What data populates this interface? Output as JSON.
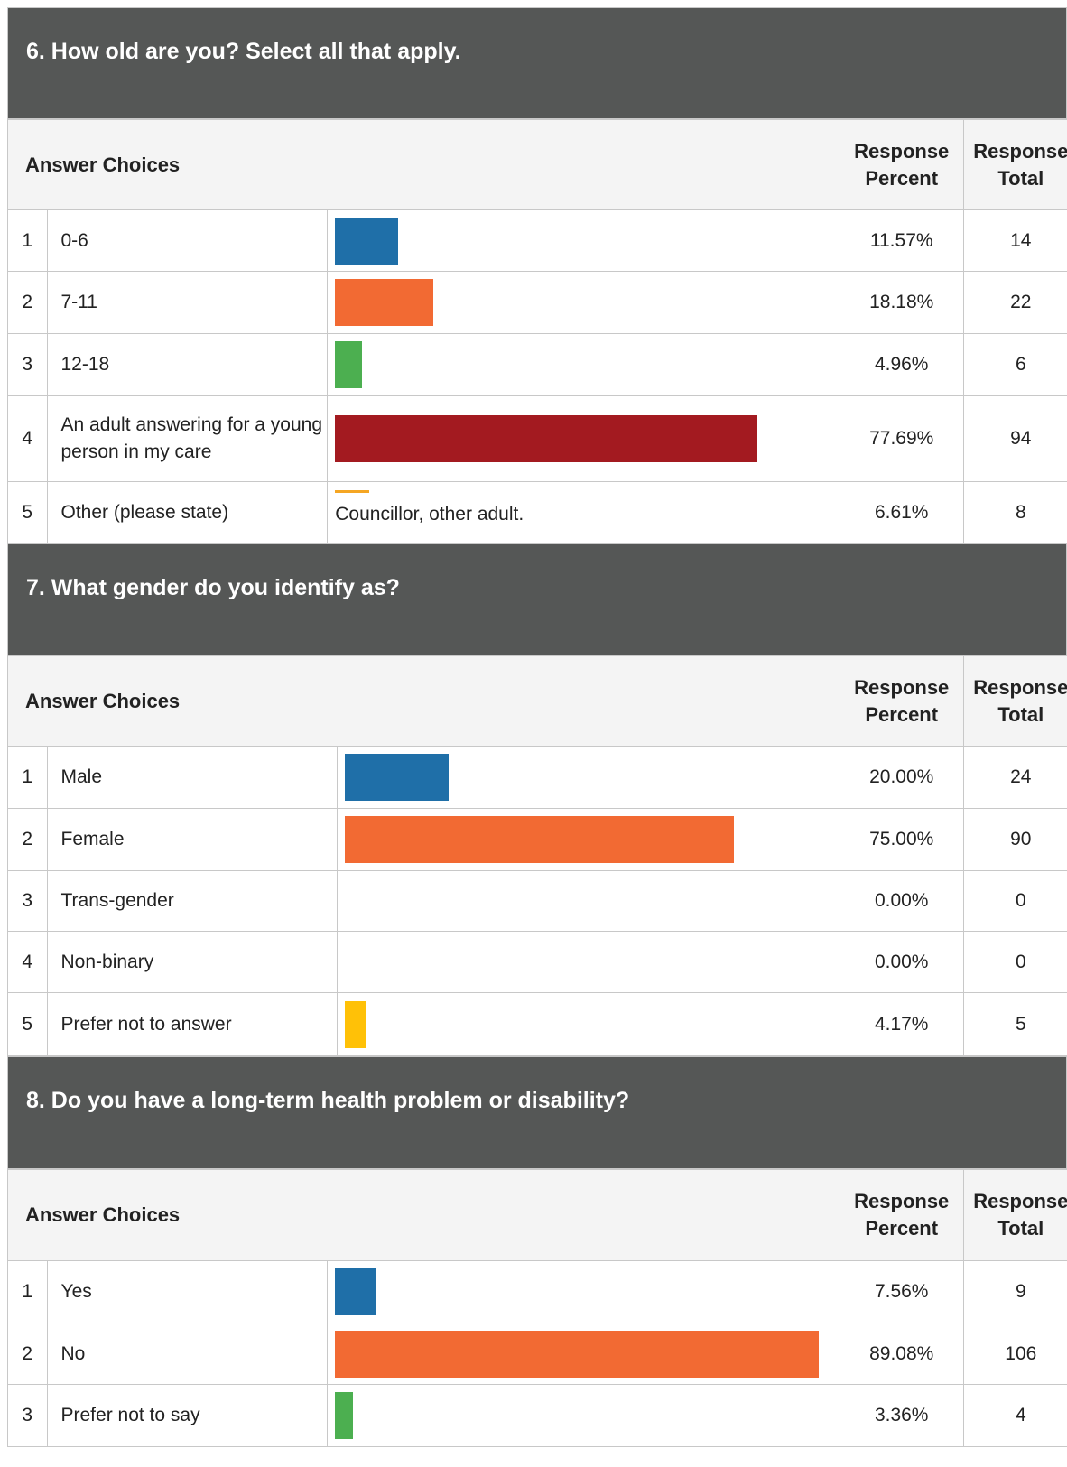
{
  "questions": [
    {
      "title": "6. How old are you? Select all that apply.",
      "header": {
        "answer_choices": "Answer Choices",
        "percent_line1": "Response",
        "percent_line2": "Percent",
        "total_line1": "Response",
        "total_line2": "Total"
      },
      "rows": [
        {
          "n": "1",
          "label": "0-6",
          "percent": "11.57%",
          "total": "14",
          "value": 11.57,
          "color": "#1f6fa8"
        },
        {
          "n": "2",
          "label": "7-11",
          "percent": "18.18%",
          "total": "22",
          "value": 18.18,
          "color": "#f26a33"
        },
        {
          "n": "3",
          "label": "12-18",
          "percent": "4.96%",
          "total": "6",
          "value": 4.96,
          "color": "#4caf50"
        },
        {
          "n": "4",
          "label": "An adult answering for a young person in my care",
          "percent": "77.69%",
          "total": "94",
          "value": 77.69,
          "color": "#a31a20"
        },
        {
          "n": "5",
          "label": "Other (please state)",
          "percent": "6.61%",
          "total": "8",
          "value": 6.61,
          "color": "#f5a623",
          "other_text": "Councillor, other adult."
        }
      ]
    },
    {
      "title": "7. What gender do you identify as?",
      "header": {
        "answer_choices": "Answer Choices",
        "percent_line1": "Response",
        "percent_line2": "Percent",
        "total_line1": "Response",
        "total_line2": "Total"
      },
      "rows": [
        {
          "n": "1",
          "label": "Male",
          "percent": "20.00%",
          "total": "24",
          "value": 20.0,
          "color": "#1f6fa8"
        },
        {
          "n": "2",
          "label": "Female",
          "percent": "75.00%",
          "total": "90",
          "value": 75.0,
          "color": "#f26a33"
        },
        {
          "n": "3",
          "label": "Trans-gender",
          "percent": "0.00%",
          "total": "0",
          "value": 0,
          "color": "#4caf50"
        },
        {
          "n": "4",
          "label": "Non-binary",
          "percent": "0.00%",
          "total": "0",
          "value": 0,
          "color": "#a31a20"
        },
        {
          "n": "5",
          "label": "Prefer not to answer",
          "percent": "4.17%",
          "total": "5",
          "value": 4.17,
          "color": "#ffc107"
        }
      ]
    },
    {
      "title": "8. Do you have a long-term health problem or disability?",
      "header": {
        "answer_choices": "Answer Choices",
        "percent_line1": "Response",
        "percent_line2": "Percent",
        "total_line1": "Response",
        "total_line2": "Total"
      },
      "rows": [
        {
          "n": "1",
          "label": "Yes",
          "percent": "7.56%",
          "total": "9",
          "value": 7.56,
          "color": "#1f6fa8"
        },
        {
          "n": "2",
          "label": "No",
          "percent": "89.08%",
          "total": "106",
          "value": 89.08,
          "color": "#f26a33"
        },
        {
          "n": "3",
          "label": "Prefer not to say",
          "percent": "3.36%",
          "total": "4",
          "value": 3.36,
          "color": "#4caf50"
        }
      ]
    }
  ]
}
